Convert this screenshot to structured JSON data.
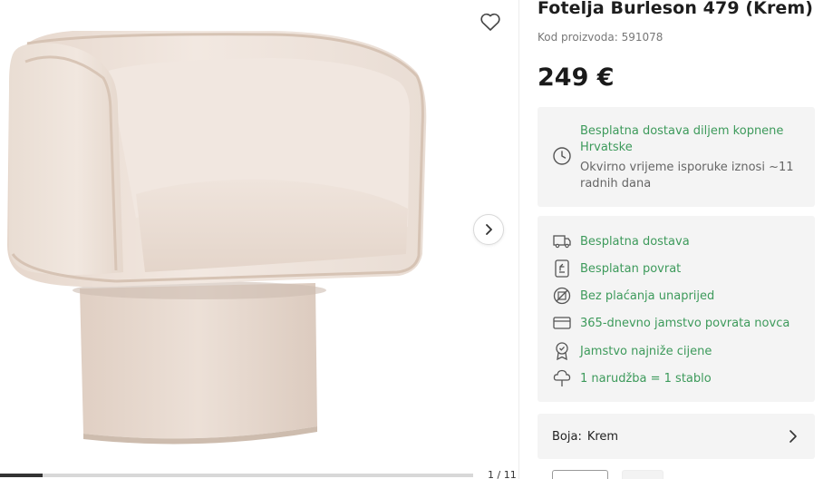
{
  "gallery": {
    "counter": "1 / 11",
    "progress": 0.09,
    "image_alt": "Fotelja Burleson 479 (Krem)",
    "favorite_icon": "heart-outline-icon",
    "next_icon": "chevron-right-icon"
  },
  "product": {
    "title": "Fotelja Burleson 479 (Krem)",
    "code": "Kod proizvoda: 591078",
    "price": "249 €"
  },
  "delivery": {
    "icon": "clock-icon",
    "title": "Besplatna dostava diljem kopnene Hrvatske",
    "subtitle": "Okvirno vrijeme isporuke iznosi ~11 radnih dana"
  },
  "benefits": [
    {
      "icon": "truck-icon",
      "label": "Besplatna dostava"
    },
    {
      "icon": "return-icon",
      "label": "Besplatan povrat"
    },
    {
      "icon": "no-prepayment-icon",
      "label": "Bez plaćanja unaprijed"
    },
    {
      "icon": "money-back-icon",
      "label": "365-dnevno jamstvo povrata novca"
    },
    {
      "icon": "badge-icon",
      "label": "Jamstvo najniže cijene"
    },
    {
      "icon": "tree-icon",
      "label": "1 narudžba = 1 stablo"
    }
  ],
  "variant": {
    "label": "Boja:",
    "value": "Krem",
    "icon": "chevron-right-icon"
  },
  "colors": {
    "accent_green": "#3d9a5b",
    "panel_bg": "#f4f4f4",
    "fabric": "#eee0d6"
  }
}
